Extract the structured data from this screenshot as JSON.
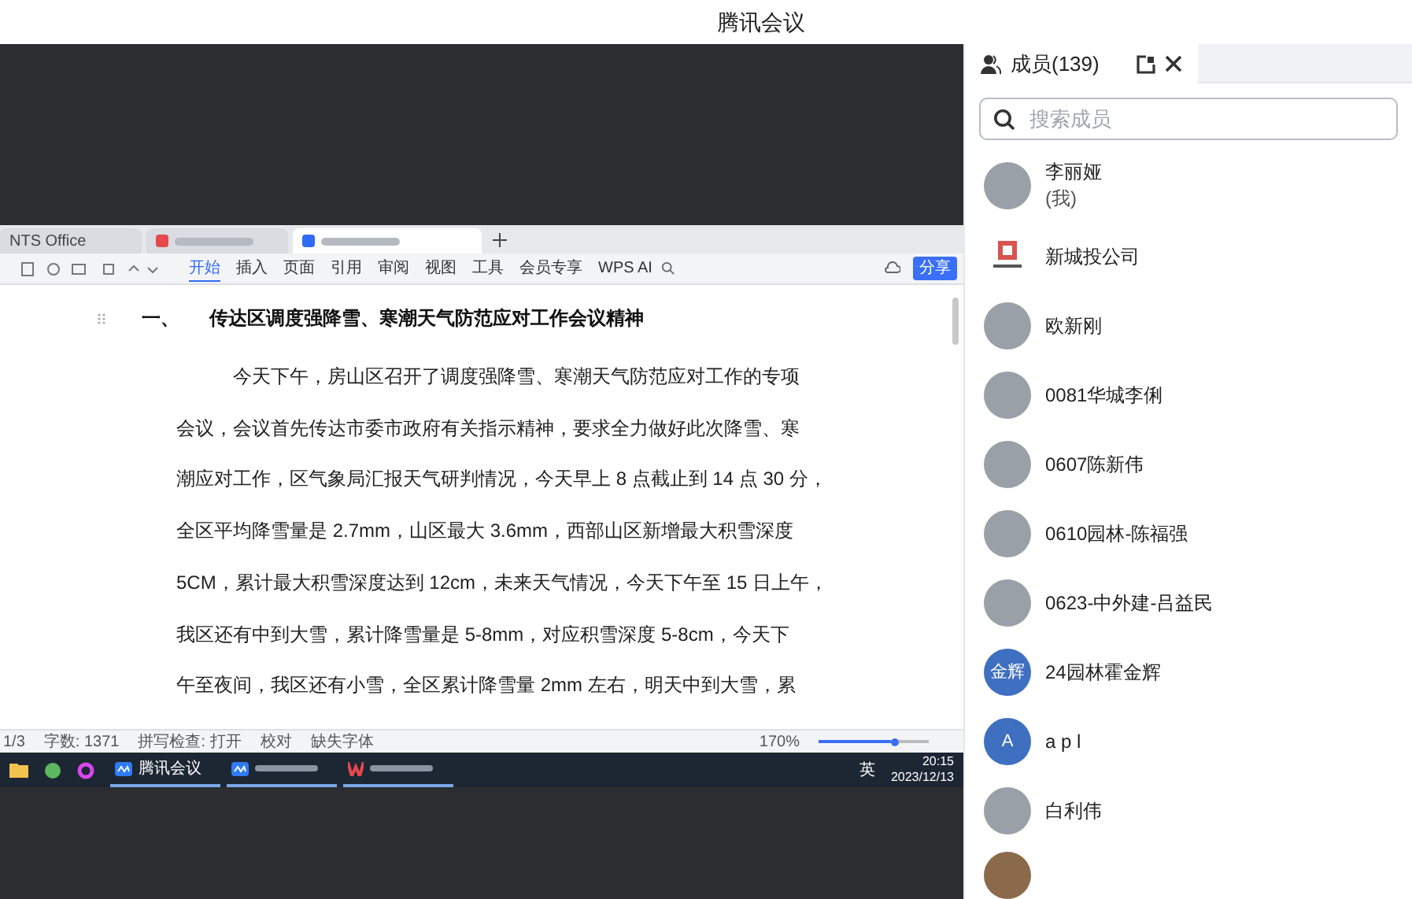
{
  "window": {
    "title": "腾讯会议"
  },
  "shared_screen": {
    "tabs": [
      {
        "kind": "text",
        "label": "NTS Office",
        "selected": false
      },
      {
        "kind": "blurred",
        "selected": false
      },
      {
        "kind": "blurred",
        "selected": true
      }
    ],
    "ribbon": [
      {
        "label": "开始",
        "selected": true
      },
      {
        "label": "插入",
        "selected": false
      },
      {
        "label": "页面",
        "selected": false
      },
      {
        "label": "引用",
        "selected": false
      },
      {
        "label": "审阅",
        "selected": false
      },
      {
        "label": "视图",
        "selected": false
      },
      {
        "label": "工具",
        "selected": false
      },
      {
        "label": "会员专享",
        "selected": false
      },
      {
        "label": "WPS AI",
        "selected": false
      }
    ],
    "share_button": "分享",
    "heading_number": "一、",
    "heading": "传达区调度强降雪、寒潮天气防范应对工作会议精神",
    "paragraph_lines": [
      "今天下午，房山区召开了调度强降雪、寒潮天气防范应对工作的专项",
      "会议，会议首先传达市委市政府有关指示精神，要求全力做好此次降雪、寒",
      "潮应对工作，区气象局汇报天气研判情况，今天早上 8 点截止到 14 点 30 分，",
      "全区平均降雪量是 2.7mm，山区最大 3.6mm，西部山区新增最大积雪深度",
      "5CM，累计最大积雪深度达到 12cm，未来天气情况，今天下午至 15 日上午，",
      "我区还有中到大雪，累计降雪量是 5-8mm，对应积雪深度 5-8cm，今天下",
      "午至夜间，我区还有小雪，全区累计降雪量 2mm 左右，明天中到大雪，累"
    ],
    "status_bar": [
      "1/3",
      "字数: 1371",
      "拼写检查: 打开",
      "校对",
      "缺失字体"
    ],
    "zoom": "170%",
    "zoom_slider": {
      "level": 0.7
    },
    "taskbar": [
      {
        "kind": "meeting",
        "label": "腾讯会议"
      },
      {
        "kind": "meeting"
      },
      {
        "kind": "wps"
      }
    ],
    "input_language": "英",
    "clock": {
      "time": "20:15",
      "date": "2023/12/13"
    }
  },
  "members": {
    "title": "成员(139)",
    "search_placeholder": "搜索成员",
    "items": [
      {
        "name": "李丽娅",
        "note": "(我)",
        "avatar": {
          "kind": "photo"
        }
      },
      {
        "name": "新城投公司",
        "avatar": {
          "kind": "logo"
        }
      },
      {
        "name": "欧新刚",
        "avatar": {
          "kind": "photo"
        }
      },
      {
        "name": "0081华城李俐",
        "avatar": {
          "kind": "photo"
        }
      },
      {
        "name": "0607陈新伟",
        "avatar": {
          "kind": "photo"
        }
      },
      {
        "name": "0610园林-陈福强",
        "avatar": {
          "kind": "photo"
        }
      },
      {
        "name": "0623-中外建-吕益民",
        "avatar": {
          "kind": "photo"
        }
      },
      {
        "name": "24园林霍金辉",
        "avatar": {
          "kind": "text",
          "text": "金辉"
        }
      },
      {
        "name": "a p l",
        "avatar": {
          "kind": "text",
          "text": "A"
        }
      },
      {
        "name": "白利伟",
        "avatar": {
          "kind": "photo"
        }
      }
    ]
  }
}
